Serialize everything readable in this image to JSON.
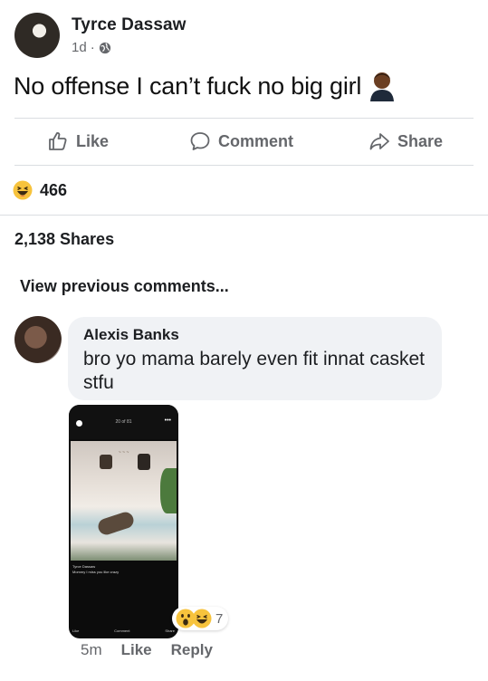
{
  "post": {
    "author": "Tyrce Dassaw",
    "time": "1d",
    "separator": "·",
    "text": "No offense I can’t fuck no big girl"
  },
  "actions": {
    "like": "Like",
    "comment": "Comment",
    "share": "Share"
  },
  "reactions": {
    "count": "466"
  },
  "shares": "2,138 Shares",
  "view_previous": "View previous comments...",
  "comment": {
    "author": "Alexis Banks",
    "text": "bro yo mama barely even fit innat casket stfu",
    "attachment": {
      "title": "20 of 81",
      "caption_name": "Tyrce Dassaw",
      "caption_text": "Mommy I miss you like crazy",
      "bar_like": "Like",
      "bar_comment": "Comment",
      "bar_share": "Share"
    },
    "reaction_count": "7",
    "time": "5m",
    "like": "Like",
    "reply": "Reply"
  },
  "colors": {
    "muted": "#65676b",
    "bubble": "#f0f2f5",
    "divider": "#dadde1",
    "text": "#1c1e21"
  },
  "icons": [
    "globe-icon",
    "person-emoji-icon",
    "thumbs-up-icon",
    "comment-icon",
    "share-icon",
    "haha-icon",
    "wow-icon"
  ]
}
